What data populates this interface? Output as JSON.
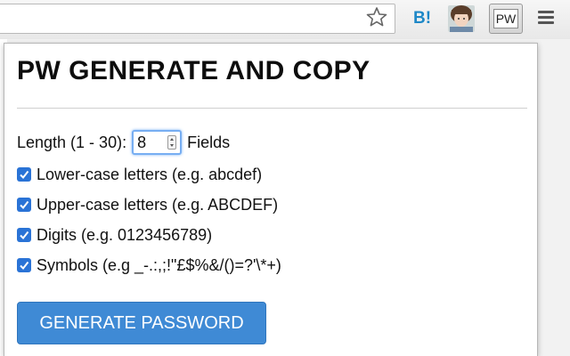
{
  "toolbar": {
    "hatena_label": "B!",
    "extension_label": "PW",
    "icons": [
      "star-icon",
      "hatena-bookmark-icon",
      "avatar-icon",
      "pw-extension-icon",
      "menu-icon"
    ]
  },
  "popup": {
    "title": "PW GENERATE AND COPY",
    "length": {
      "label": "Length (1 - 30):",
      "value": "8",
      "suffix": "Fields"
    },
    "options": [
      {
        "label": "Lower-case letters (e.g. abcdef)",
        "checked": true
      },
      {
        "label": "Upper-case letters (e.g. ABCDEF)",
        "checked": true
      },
      {
        "label": "Digits (e.g. 0123456789)",
        "checked": true
      },
      {
        "label": "Symbols (e.g _-.:,;!\"£$%&/()=?'\\*+)",
        "checked": true
      }
    ],
    "generate_button": "GENERATE PASSWORD"
  },
  "colors": {
    "accent": "#3f8ad5",
    "checkbox": "#2a73d6",
    "focus_ring": "#77aef2",
    "hatena": "#1e88c7"
  }
}
